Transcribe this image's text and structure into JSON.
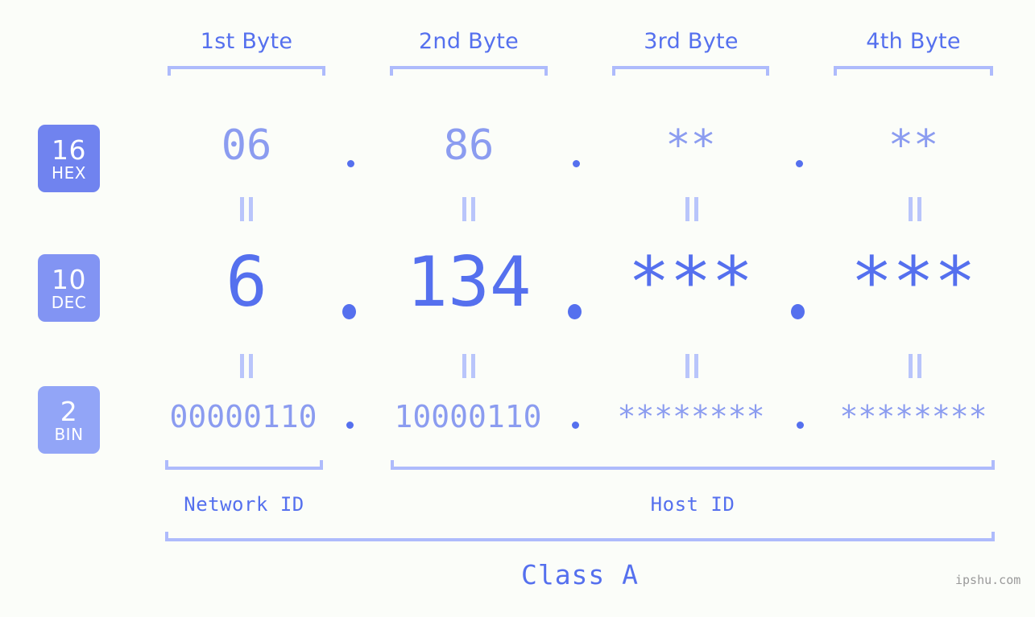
{
  "page": {
    "background_color": "#fbfdf9",
    "accent_color": "#5570ee",
    "light_accent_color": "#aebbfc",
    "muted_value_color": "#8b9cf0"
  },
  "byte_headers": [
    {
      "label": "1st Byte"
    },
    {
      "label": "2nd Byte"
    },
    {
      "label": "3rd Byte"
    },
    {
      "label": "4th Byte"
    }
  ],
  "rows": [
    {
      "badge": {
        "base": "16",
        "name": "HEX",
        "color": "#7083ef"
      },
      "values": [
        "06",
        "86",
        "**",
        "**"
      ],
      "separator": "."
    },
    {
      "badge": {
        "base": "10",
        "name": "DEC",
        "color": "#8294f3"
      },
      "values": [
        "6",
        "134",
        "***",
        "***"
      ],
      "separator": "."
    },
    {
      "badge": {
        "base": "2",
        "name": "BIN",
        "color": "#92a5f7"
      },
      "values": [
        "00000110",
        "10000110",
        "********",
        "********"
      ],
      "separator": "."
    }
  ],
  "equals_symbol": "||",
  "id_sections": [
    {
      "label": "Network ID"
    },
    {
      "label": "Host ID"
    }
  ],
  "class": {
    "label": "Class A"
  },
  "watermark": {
    "text": "ipshu.com"
  }
}
